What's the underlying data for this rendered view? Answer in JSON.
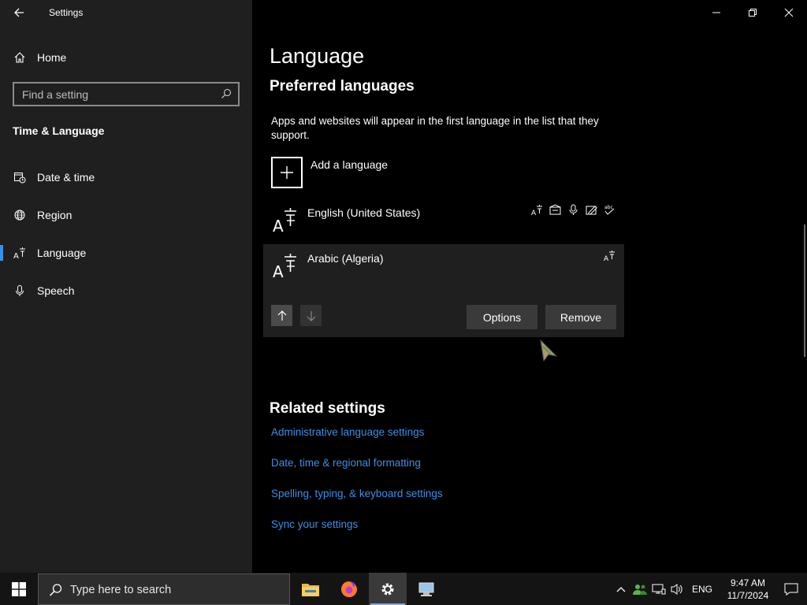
{
  "window": {
    "title": "Settings",
    "controls": {
      "minimize": "minimize-icon",
      "restore": "restore-icon",
      "close": "close-icon"
    }
  },
  "sidebar": {
    "home_label": "Home",
    "search_placeholder": "Find a setting",
    "section_heading": "Time & Language",
    "items": [
      {
        "label": "Date & time",
        "icon": "date-time-icon"
      },
      {
        "label": "Region",
        "icon": "region-globe-icon"
      },
      {
        "label": "Language",
        "icon": "language-icon",
        "selected": true
      },
      {
        "label": "Speech",
        "icon": "microphone-icon"
      }
    ]
  },
  "main": {
    "title": "Language",
    "subheading": "Preferred languages",
    "description": "Apps and websites will appear in the first language in the list that they support.",
    "add_language_label": "Add a language",
    "languages": [
      {
        "name": "English (United States)",
        "features": [
          "language-pack-icon",
          "display-language-icon",
          "speech-icon",
          "handwriting-icon",
          "spell-check-icon"
        ]
      },
      {
        "name": "Arabic (Algeria)",
        "features": [
          "language-pack-icon"
        ],
        "selected": true
      }
    ],
    "buttons": {
      "options": "Options",
      "remove": "Remove"
    },
    "related_heading": "Related settings",
    "related_links": [
      "Administrative language settings",
      "Date, time & regional formatting",
      "Spelling, typing, & keyboard settings",
      "Sync your settings"
    ]
  },
  "taskbar": {
    "search_placeholder": "Type here to search",
    "apps": [
      "file-explorer-icon",
      "firefox-icon",
      "settings-gear-icon",
      "network-app-icon"
    ],
    "tray": {
      "language": "ENG",
      "time": "9:47 AM",
      "date": "11/7/2024"
    }
  },
  "colors": {
    "accent": "#3b8ee6",
    "sidebar_bg": "#1f1f1f",
    "main_bg": "#000000",
    "link": "#3b8ee6"
  }
}
